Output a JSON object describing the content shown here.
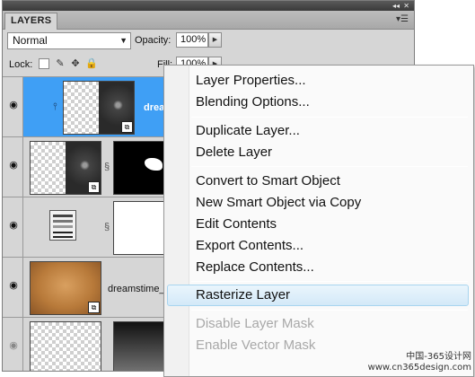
{
  "panel": {
    "tab_label": "LAYERS",
    "collapse_icon": "double-arrow-icon",
    "close_icon": "close-icon",
    "menu_icon": "panel-menu-icon",
    "blend_mode": "Normal",
    "opacity_label": "Opacity:",
    "opacity_value": "100%",
    "lock_label": "Lock:",
    "fill_label": "Fill:",
    "fill_value": "100%"
  },
  "layers": [
    {
      "name": "drea",
      "selected": true,
      "visible": true,
      "type": "smart-object"
    },
    {
      "name": "",
      "selected": false,
      "visible": true,
      "type": "smart-object-with-mask"
    },
    {
      "name": "",
      "selected": false,
      "visible": true,
      "type": "adjustment-with-mask"
    },
    {
      "name": "dreamstime_",
      "selected": false,
      "visible": true,
      "type": "smart-object"
    },
    {
      "name": "",
      "selected": false,
      "visible": true,
      "type": "layer-with-mask"
    }
  ],
  "context_menu": {
    "items": [
      {
        "label": "Layer Properties..."
      },
      {
        "label": "Blending Options..."
      },
      {
        "label": "Duplicate Layer..."
      },
      {
        "label": "Delete Layer"
      },
      {
        "label": "Convert to Smart Object"
      },
      {
        "label": "New Smart Object via Copy"
      },
      {
        "label": "Edit Contents"
      },
      {
        "label": "Export Contents..."
      },
      {
        "label": "Replace Contents..."
      },
      {
        "label": "Rasterize Layer",
        "highlighted": true
      },
      {
        "label": "Disable Layer Mask",
        "disabled": true
      },
      {
        "label": "Enable Vector Mask",
        "disabled": true
      }
    ]
  },
  "watermark": {
    "line1": "中国-365设计网",
    "line2": "www.cn365design.com"
  },
  "colors": {
    "selection": "#3f9ff5",
    "menu_highlight": "#d3e9f8"
  }
}
